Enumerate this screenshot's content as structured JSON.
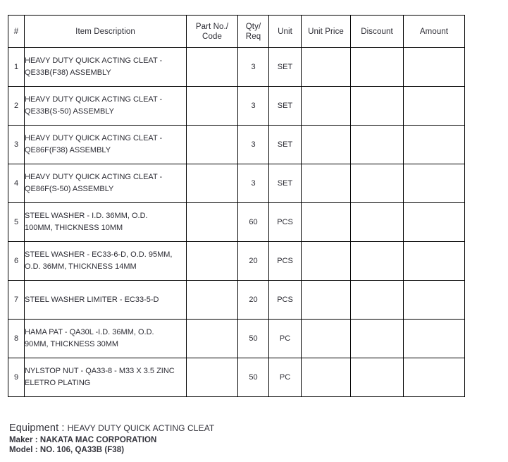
{
  "table": {
    "columns": [
      {
        "key": "idx",
        "label": "#"
      },
      {
        "key": "desc",
        "label": "Item Description"
      },
      {
        "key": "part",
        "label_line1": "Part No./",
        "label_line2": "Code"
      },
      {
        "key": "qty",
        "label_line1": "Qty/",
        "label_line2": "Req"
      },
      {
        "key": "unit",
        "label": "Unit"
      },
      {
        "key": "price",
        "label": "Unit Price"
      },
      {
        "key": "disc",
        "label": "Discount"
      },
      {
        "key": "amount",
        "label": "Amount"
      }
    ],
    "rows": [
      {
        "idx": "1",
        "desc_line1": "HEAVY DUTY QUICK ACTING CLEAT -",
        "desc_line2": "QE33B(F38) ASSEMBLY",
        "part": "",
        "qty": "3",
        "unit": "SET",
        "price": "",
        "disc": "",
        "amount": ""
      },
      {
        "idx": "2",
        "desc_line1": "HEAVY DUTY QUICK ACTING CLEAT -",
        "desc_line2": "QE33B(S-50) ASSEMBLY",
        "part": "",
        "qty": "3",
        "unit": "SET",
        "price": "",
        "disc": "",
        "amount": ""
      },
      {
        "idx": "3",
        "desc_line1": "HEAVY DUTY QUICK ACTING CLEAT -",
        "desc_line2": "QE86F(F38) ASSEMBLY",
        "part": "",
        "qty": "3",
        "unit": "SET",
        "price": "",
        "disc": "",
        "amount": ""
      },
      {
        "idx": "4",
        "desc_line1": "HEAVY DUTY QUICK ACTING CLEAT -",
        "desc_line2": "QE86F(S-50) ASSEMBLY",
        "part": "",
        "qty": "3",
        "unit": "SET",
        "price": "",
        "disc": "",
        "amount": ""
      },
      {
        "idx": "5",
        "desc_line1": "STEEL WASHER - I.D. 36MM, O.D.",
        "desc_line2": "100MM, THICKNESS 10MM",
        "part": "",
        "qty": "60",
        "unit": "PCS",
        "price": "",
        "disc": "",
        "amount": ""
      },
      {
        "idx": "6",
        "desc_line1": "STEEL WASHER - EC33-6-D, O.D. 95MM,",
        "desc_line2": "O.D. 36MM, THICKNESS 14MM",
        "part": "",
        "qty": "20",
        "unit": "PCS",
        "price": "",
        "disc": "",
        "amount": ""
      },
      {
        "idx": "7",
        "desc_line1": "STEEL WASHER LIMITER - EC33-5-D",
        "desc_line2": "",
        "part": "",
        "qty": "20",
        "unit": "PCS",
        "price": "",
        "disc": "",
        "amount": ""
      },
      {
        "idx": "8",
        "desc_line1": "HAMA PAT - QA30L -I.D. 36MM, O.D.",
        "desc_line2": "90MM, THICKNESS 30MM",
        "part": "",
        "qty": "50",
        "unit": "PC",
        "price": "",
        "disc": "",
        "amount": ""
      },
      {
        "idx": "9",
        "desc_line1": "NYLSTOP NUT - QA33-8 - M33 X 3.5 ZINC",
        "desc_line2": "ELETRO PLATING",
        "part": "",
        "qty": "50",
        "unit": "PC",
        "price": "",
        "disc": "",
        "amount": ""
      }
    ]
  },
  "footer": {
    "equipment_label": "Equipment : ",
    "equipment_value": "HEAVY DUTY QUICK ACTING CLEAT",
    "maker": "Maker : NAKATA MAC CORPORATION",
    "model": "Model : NO. 106, QA33B (F38)"
  }
}
